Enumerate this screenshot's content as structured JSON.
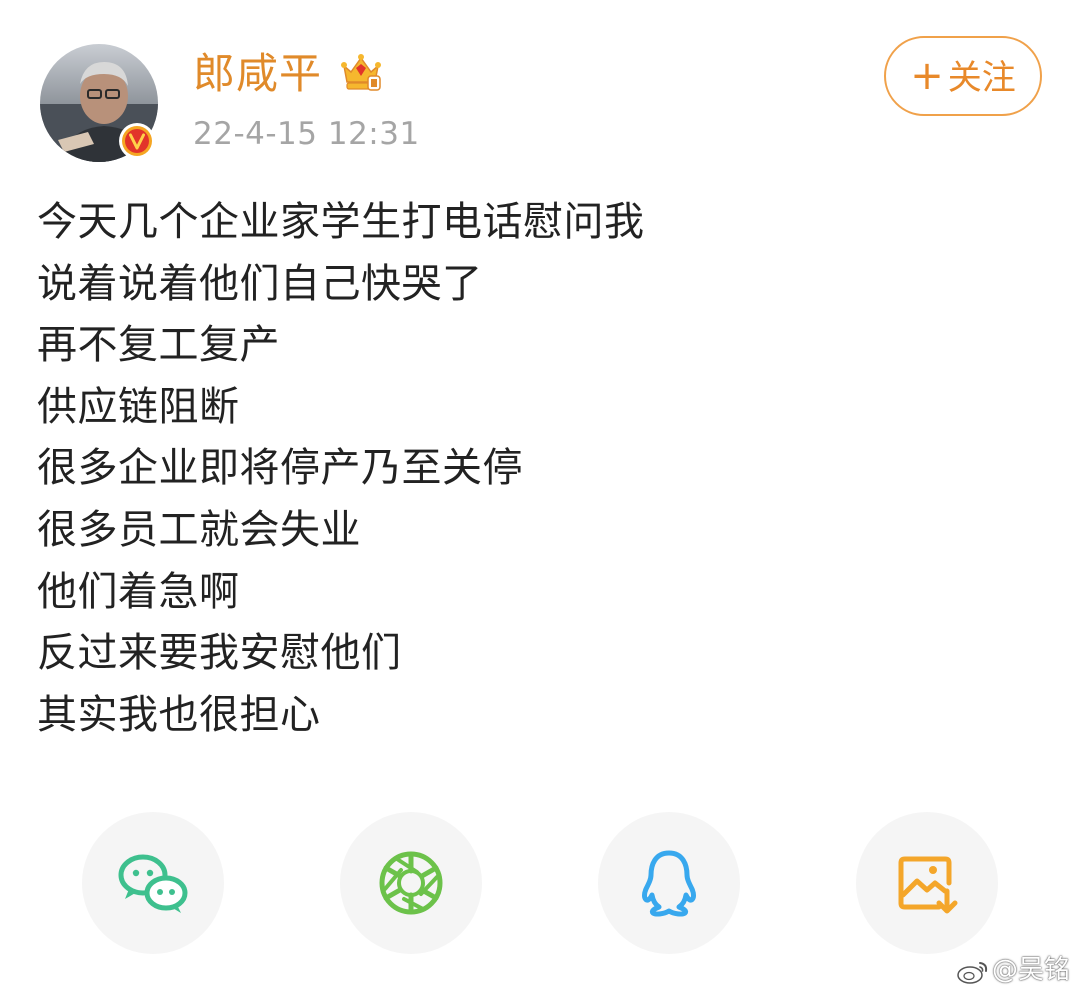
{
  "post": {
    "author": "郎咸平",
    "timestamp": "22-4-15 12:31",
    "follow_label": "关注",
    "follow_plus": "+",
    "lines": [
      "今天几个企业家学生打电话慰问我",
      "说着说着他们自己快哭了",
      "再不复工复产",
      "供应链阻断",
      "很多企业即将停产乃至关停",
      "很多员工就会失业",
      "他们着急啊",
      "反过来要我安慰他们",
      "其实我也很担心"
    ]
  },
  "share": {
    "items": [
      {
        "icon": "wechat-icon",
        "color": "#3ec08e"
      },
      {
        "icon": "moments-icon",
        "color": "#6cc24a"
      },
      {
        "icon": "qq-icon",
        "color": "#38a8ee"
      },
      {
        "icon": "save-image-icon",
        "color": "#f4a62a"
      }
    ]
  },
  "watermark": {
    "text": "@吴铭"
  },
  "colors": {
    "accent": "#e08a2a",
    "text": "#222222",
    "muted": "#a5a5a5"
  }
}
